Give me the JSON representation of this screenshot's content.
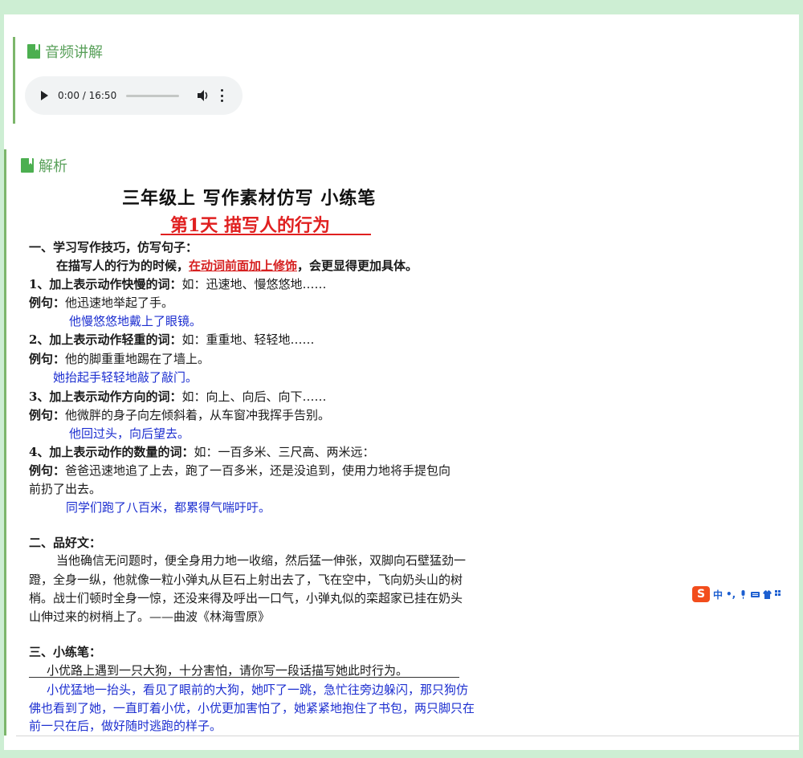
{
  "audio_section": {
    "title": "音频讲解"
  },
  "audio_player": {
    "time": "0:00 / 16:50",
    "progress_fraction": 0
  },
  "analysis_section": {
    "title": "解析"
  },
  "doc": {
    "title": "三年级上  写作素材仿写  小练笔",
    "subtitle": "第1天  描写人的行为",
    "s1_heading": "一、学习写作技巧，仿写句子：",
    "intro_a": "在描写人的行为的时候，",
    "intro_b": "在动词前面加上修饰",
    "intro_c": "，会更显得更加具体。",
    "p1_head": "1、加上表示动作快慢的词：",
    "p1_rest": "如：迅速地、慢悠悠地……",
    "p1_ex_label": "例句：",
    "p1_ex": "他迅速地举起了手。",
    "p1_ans": "他慢悠悠地戴上了眼镜。",
    "p2_head": "2、加上表示动作轻重的词：",
    "p2_rest": "如：重重地、轻轻地……",
    "p2_ex_label": "例句：",
    "p2_ex": "他的脚重重地踢在了墙上。",
    "p2_ans": "她抬起手轻轻地敲了敲门。",
    "p3_head": "3、加上表示动作方向的词：",
    "p3_rest": "如：向上、向后、向下……",
    "p3_ex_label": "例句：",
    "p3_ex": "他微胖的身子向左倾斜着，从车窗冲我挥手告别。",
    "p3_ans": "他回过头，向后望去。",
    "p4_head": "4、加上表示动作的数量的词：",
    "p4_rest": "如：一百多米、三尺高、两米远：",
    "p4_ex_label": "例句：",
    "p4_ex_l1": "爸爸迅速地追了上去，跑了一百多米，还是没追到，使用力地将手提包向",
    "p4_ex_l2": "前扔了出去。",
    "p4_ans": "同学们跑了八百米，都累得气喘吁吁。",
    "s2_heading": "二、品好文：",
    "s2_l1": "当他确信无问题时，便全身用力地一收缩，然后猛一伸张，双脚向石壁猛劲一",
    "s2_l2": "蹬，全身一纵，他就像一粒小弹丸从巨石上射出去了，飞在空中，飞向奶头山的树",
    "s2_l3": "梢。战士们顿时全身一惊，还没来得及呼出一口气，小弹丸似的栾超家已挂在奶头",
    "s2_l4": "山伸过来的树梢上了。——曲波《林海雪原》",
    "s3_heading": "三、小练笔：",
    "s3_task": "小优路上遇到一只大狗，十分害怕，请你写一段话描写她此时行为。",
    "s3_ans_l1": "小优猛地一抬头，看见了眼前的大狗，她吓了一跳，急忙往旁边躲闪，那只狗仿",
    "s3_ans_l2": "佛也看到了她，一直盯着小优，小优更加害怕了，她紧紧地抱住了书包，两只脚只在",
    "s3_ans_l3": "前一只在后，做好随时逃跑的样子。"
  },
  "ime_toolbar": {
    "logo": "S",
    "mode": "中",
    "punct": "•,"
  },
  "colors": {
    "accent_green": "#7cb66b",
    "title_green": "#5aa15b",
    "answer_blue": "#1d2fd0",
    "highlight_red": "#e02020",
    "page_bg": "#cdeed3"
  }
}
